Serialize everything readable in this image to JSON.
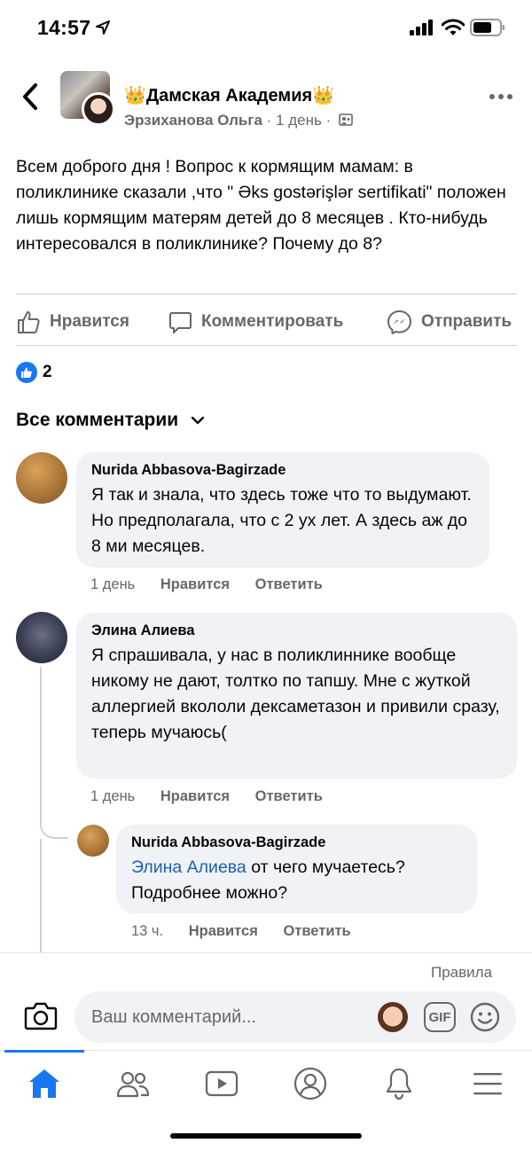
{
  "status_bar": {
    "time": "14:57"
  },
  "header": {
    "group_name": "👑Дамская Академия👑",
    "author": "Эрзиханова Ольга",
    "time": "1 день",
    "separator": "·"
  },
  "post": {
    "text": "Всем доброго дня ! Вопрос к кормящим мамам: в поликлинике сказали ,что \" Əks gostərişlər sertifikati\" положен лишь кормящим матерям детей до 8 месяцев . Кто-нибудь интересовался в поликлинике? Почему до 8?"
  },
  "actions": {
    "like": "Нравится",
    "comment": "Комментировать",
    "share": "Отправить"
  },
  "reactions": {
    "count": "2"
  },
  "comments_filter": {
    "label": "Все комментарии"
  },
  "comments": [
    {
      "name": "Nurida Abbasova-Bagirzade",
      "text": "Я так и знала, что здесь тоже что то выдумают. Но предполагала, что с 2 ух лет.  А здесь аж до 8 ми месяцев.",
      "time": "1 день",
      "like": "Нравится",
      "reply": "Ответить"
    },
    {
      "name": "Элина Алиева",
      "text": "Я спрашивала, у нас в поликлиннике вообще никому не дают, толтко по тапшу. Мне с жуткой аллергией вкололи дексаметазон и привили сразу, теперь мучаюсь(",
      "time": "1 день",
      "like": "Нравится",
      "reply": "Ответить"
    },
    {
      "name": "Nurida Abbasova-Bagirzade",
      "mention": "Элина Алиева",
      "text": " от чего мучаетесь? Подробнее можно?",
      "time": "13 ч.",
      "like": "Нравится",
      "reply": "Ответить"
    }
  ],
  "composer": {
    "rules": "Правила",
    "placeholder": "Ваш комментарий...",
    "gif": "GIF"
  },
  "tabs": [
    "home-icon",
    "friends-icon",
    "watch-icon",
    "profile-icon",
    "notifications-icon",
    "menu-icon"
  ],
  "colors": {
    "accent": "#1877f2",
    "secondary_text": "#65676b",
    "bubble": "#f0f2f5",
    "mention": "#1a61b5"
  }
}
